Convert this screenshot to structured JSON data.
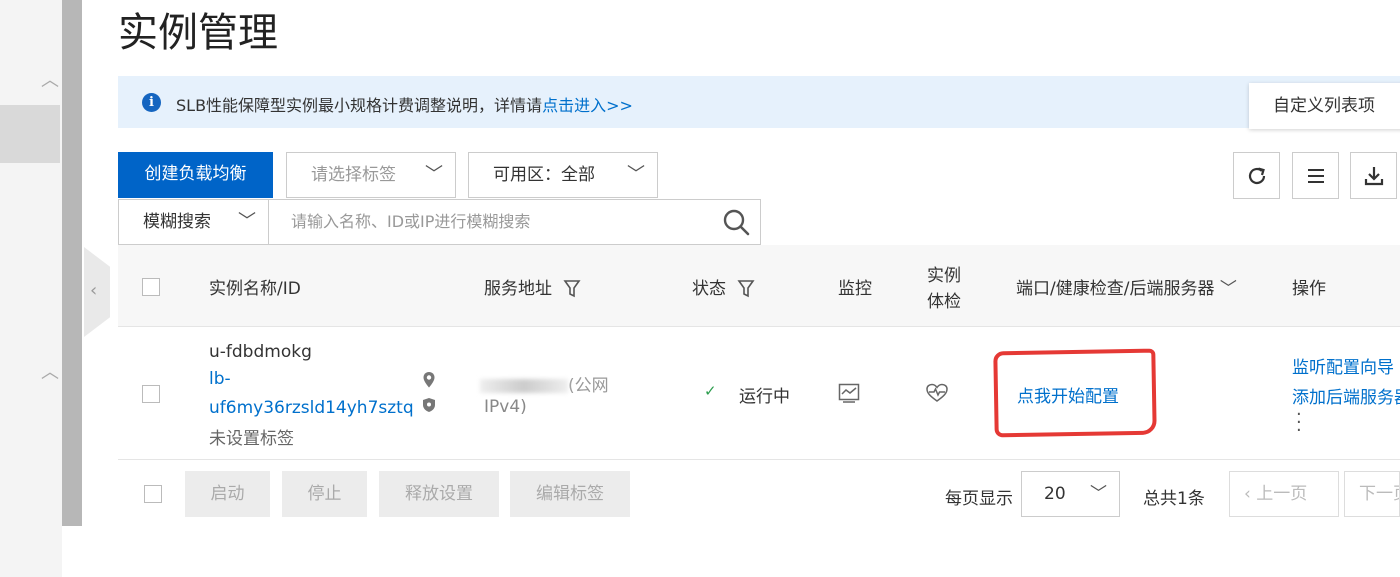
{
  "page": {
    "title": "实例管理"
  },
  "notice": {
    "text": "SLB性能保障型实例最小规格计费调整说明，详情请",
    "link": "点击进入>>"
  },
  "custom_list_label": "自定义列表项",
  "toolbar": {
    "create_label": "创建负载均衡",
    "tag_placeholder": "请选择标签",
    "zone_label": "可用区：",
    "zone_value": "全部",
    "search_mode": "模糊搜索",
    "search_placeholder": "请输入名称、ID或IP进行模糊搜索"
  },
  "table": {
    "headers": {
      "name": "实例名称/ID",
      "address": "服务地址",
      "status": "状态",
      "monitor": "监控",
      "health_1": "实例",
      "health_2": "体检",
      "ports": "端口/健康检查/后端服务器",
      "actions": "操作"
    },
    "rows": [
      {
        "name": "u-fdbdmokg",
        "id_1": "lb-",
        "id_2": "uf6my36rzsld14yh7sztq",
        "tag": "未设置标签",
        "address_suffix": "(公网",
        "address_type": "IPv4)",
        "status": "运行中",
        "config_link": "点我开始配置",
        "action_1": "监听配置向导",
        "action_2": "添加后端服务器"
      }
    ]
  },
  "footer": {
    "start": "启动",
    "stop": "停止",
    "release": "释放设置",
    "edit_tags": "编辑标签",
    "per_page_label": "每页显示",
    "per_page_value": "20",
    "total": "总共1条",
    "prev": "上一页",
    "next": "下一页"
  },
  "colors": {
    "primary": "#0064c8",
    "link": "#0070cc",
    "notice_bg": "#e6f1fc",
    "status_ok": "#2e9e4f",
    "annotation": "#e53935"
  }
}
